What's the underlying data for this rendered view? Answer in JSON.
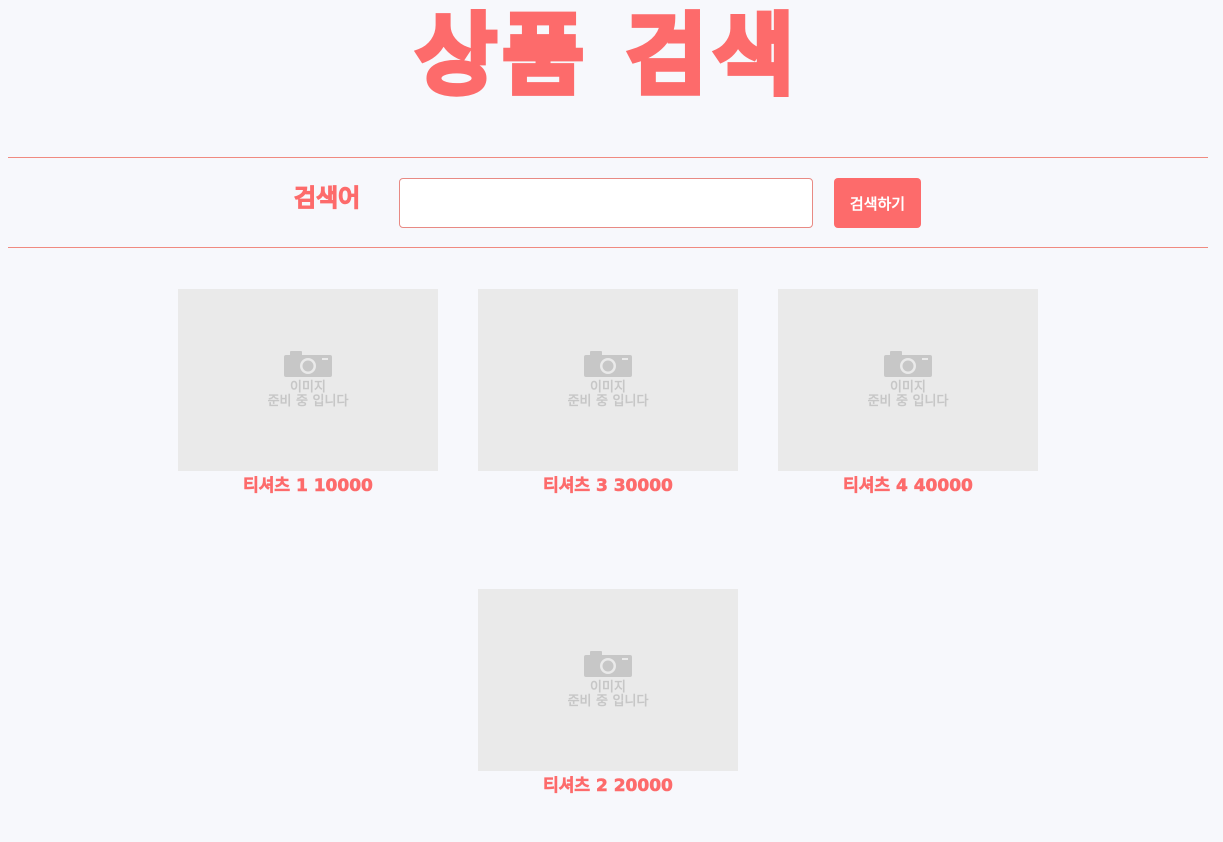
{
  "page": {
    "title": "상품 검색"
  },
  "search": {
    "label": "검색어",
    "value": "",
    "placeholder": "",
    "button_label": "검색하기"
  },
  "products": [
    {
      "name": "티셔츠 1",
      "price": "10000",
      "caption": "티셔츠 1 10000",
      "placeholder_line1": "이미지",
      "placeholder_line2": "준비 중 입니다"
    },
    {
      "name": "티셔츠 3",
      "price": "30000",
      "caption": "티셔츠 3 30000",
      "placeholder_line1": "이미지",
      "placeholder_line2": "준비 중 입니다"
    },
    {
      "name": "티셔츠 4",
      "price": "40000",
      "caption": "티셔츠 4 40000",
      "placeholder_line1": "이미지",
      "placeholder_line2": "준비 중 입니다"
    },
    {
      "name": "티셔츠 2",
      "price": "20000",
      "caption": "티셔츠 2 20000",
      "placeholder_line1": "이미지",
      "placeholder_line2": "준비 중 입니다"
    }
  ],
  "colors": {
    "accent": "#fd6b6b",
    "background": "#f7f8fc",
    "placeholder_bg": "#eaeaea",
    "placeholder_icon": "#c7c7c7"
  },
  "icons": {
    "image_placeholder": "camera-icon"
  }
}
